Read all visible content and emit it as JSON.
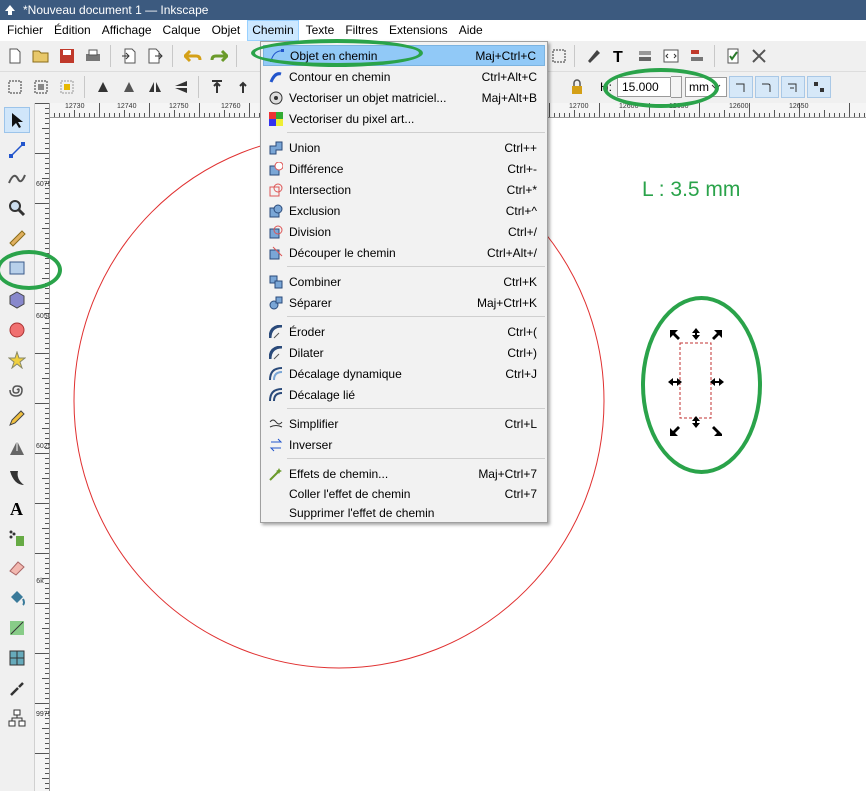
{
  "window": {
    "title": "*Nouveau document 1 — Inkscape"
  },
  "menubar": {
    "items": [
      "Fichier",
      "Édition",
      "Affichage",
      "Calque",
      "Objet",
      "Chemin",
      "Texte",
      "Filtres",
      "Extensions",
      "Aide"
    ],
    "active": "Chemin"
  },
  "toolbar2": {
    "h_label": "H:",
    "h_value": "15.000",
    "unit": "mm"
  },
  "ruler": {
    "h_labels": [
      "12730",
      "12740",
      "12750",
      "12760",
      "12700",
      "12600",
      "12650",
      "12600",
      "12650"
    ],
    "v_labels": [
      "6075",
      "6050",
      "6025",
      "6k",
      "9975"
    ]
  },
  "chemin_menu": {
    "items": [
      {
        "label": "Objet en chemin",
        "shortcut": "Maj+Ctrl+C",
        "icon": "object-to-path-icon"
      },
      {
        "label": "Contour en chemin",
        "shortcut": "Ctrl+Alt+C",
        "icon": "stroke-to-path-icon"
      },
      {
        "label": "Vectoriser un objet matriciel...",
        "shortcut": "Maj+Alt+B",
        "icon": "trace-bitmap-icon"
      },
      {
        "label": "Vectoriser du pixel art...",
        "shortcut": "",
        "icon": "trace-pixel-art-icon"
      },
      {
        "label": "Union",
        "shortcut": "Ctrl++",
        "icon": "union-icon"
      },
      {
        "label": "Différence",
        "shortcut": "Ctrl+-",
        "icon": "difference-icon"
      },
      {
        "label": "Intersection",
        "shortcut": "Ctrl+*",
        "icon": "intersection-icon"
      },
      {
        "label": "Exclusion",
        "shortcut": "Ctrl+^",
        "icon": "exclusion-icon"
      },
      {
        "label": "Division",
        "shortcut": "Ctrl+/",
        "icon": "division-icon"
      },
      {
        "label": "Découper le chemin",
        "shortcut": "Ctrl+Alt+/",
        "icon": "cut-path-icon"
      },
      {
        "label": "Combiner",
        "shortcut": "Ctrl+K",
        "icon": "combine-icon"
      },
      {
        "label": "Séparer",
        "shortcut": "Maj+Ctrl+K",
        "icon": "break-apart-icon"
      },
      {
        "label": "Éroder",
        "shortcut": "Ctrl+(",
        "icon": "inset-icon"
      },
      {
        "label": "Dilater",
        "shortcut": "Ctrl+)",
        "icon": "outset-icon"
      },
      {
        "label": "Décalage dynamique",
        "shortcut": "Ctrl+J",
        "icon": "dynamic-offset-icon"
      },
      {
        "label": "Décalage lié",
        "shortcut": "",
        "icon": "linked-offset-icon"
      },
      {
        "label": "Simplifier",
        "shortcut": "Ctrl+L",
        "icon": "simplify-icon"
      },
      {
        "label": "Inverser",
        "shortcut": "",
        "icon": "reverse-icon"
      },
      {
        "label": "Effets de chemin...",
        "shortcut": "Maj+Ctrl+7",
        "icon": "path-effects-icon"
      },
      {
        "label": "Coller l'effet de chemin",
        "shortcut": "Ctrl+7",
        "icon": ""
      },
      {
        "label": "Supprimer l'effet de chemin",
        "shortcut": "",
        "icon": ""
      }
    ]
  },
  "annotation": {
    "text": "L : 3.5 mm",
    "color": "#2aa34a"
  },
  "colors": {
    "titlebar": "#3c5a7f",
    "highlight": "#91c9f7",
    "circle_stroke": "#e03030",
    "annotation": "#2aa34a"
  }
}
